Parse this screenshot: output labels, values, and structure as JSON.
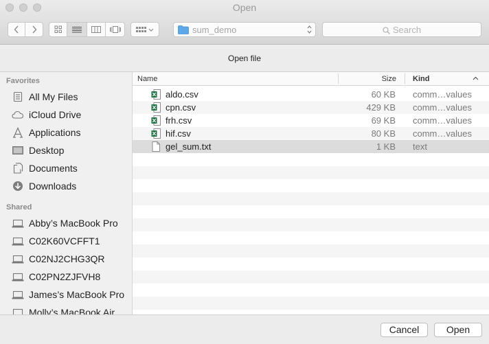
{
  "window": {
    "title": "Open"
  },
  "toolbar": {
    "location": "sum_demo",
    "search_placeholder": "Search"
  },
  "message": "Open file",
  "sidebar": {
    "favorites_heading": "Favorites",
    "favorites": [
      {
        "label": "All My Files",
        "icon": "all-files-icon"
      },
      {
        "label": "iCloud Drive",
        "icon": "cloud-icon"
      },
      {
        "label": "Applications",
        "icon": "applications-icon"
      },
      {
        "label": "Desktop",
        "icon": "desktop-icon"
      },
      {
        "label": "Documents",
        "icon": "documents-icon"
      },
      {
        "label": "Downloads",
        "icon": "downloads-icon"
      }
    ],
    "shared_heading": "Shared",
    "shared": [
      {
        "label": "Abby’s MacBook Pro",
        "icon": "laptop-icon"
      },
      {
        "label": "C02K60VCFFT1",
        "icon": "laptop-icon"
      },
      {
        "label": "C02NJ2CHG3QR",
        "icon": "laptop-icon"
      },
      {
        "label": "C02PN2ZJFVH8",
        "icon": "laptop-icon"
      },
      {
        "label": "James’s MacBook Pro",
        "icon": "laptop-icon"
      },
      {
        "label": "Molly’s MacBook Air",
        "icon": "laptop-icon"
      }
    ]
  },
  "file_list": {
    "columns": {
      "name": "Name",
      "size": "Size",
      "kind": "Kind"
    },
    "files": [
      {
        "name": "aldo.csv",
        "size": "60 KB",
        "kind": "comm…values",
        "icon": "excel-file-icon"
      },
      {
        "name": "cpn.csv",
        "size": "429 KB",
        "kind": "comm…values",
        "icon": "excel-file-icon"
      },
      {
        "name": "frh.csv",
        "size": "69 KB",
        "kind": "comm…values",
        "icon": "excel-file-icon"
      },
      {
        "name": "hif.csv",
        "size": "80 KB",
        "kind": "comm…values",
        "icon": "excel-file-icon"
      },
      {
        "name": "gel_sum.txt",
        "size": "1 KB",
        "kind": "text",
        "icon": "text-file-icon",
        "selected": true
      }
    ]
  },
  "footer": {
    "cancel": "Cancel",
    "open": "Open"
  },
  "colors": {
    "excel_green": "#1f7244",
    "folder_blue": "#5fa8e8",
    "selection": "#dcdcdc"
  }
}
